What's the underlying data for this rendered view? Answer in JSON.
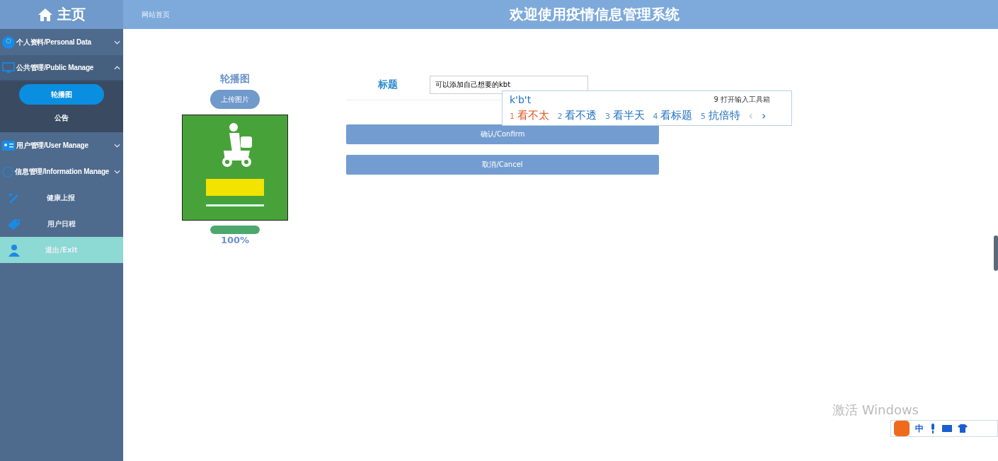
{
  "sidebar": {
    "home": "主页",
    "items": [
      {
        "kind": "group",
        "label": "个人资料/Personal Data",
        "expanded": false
      },
      {
        "kind": "group",
        "label": "公共管理/Public Manage",
        "expanded": true,
        "children": [
          {
            "label": "轮播图",
            "selected": true
          },
          {
            "label": "公告",
            "selected": false
          }
        ]
      },
      {
        "kind": "group",
        "label": "用户管理/User Manage",
        "expanded": false
      },
      {
        "kind": "group",
        "label": "信息管理/Information Manage",
        "expanded": false
      },
      {
        "kind": "link",
        "label": "健康上报",
        "selected": false
      },
      {
        "kind": "link",
        "label": "用户日程",
        "selected": false
      },
      {
        "kind": "link",
        "label": "退出/Exit",
        "selected": true
      }
    ]
  },
  "header": {
    "breadcrumb": "网站首页",
    "title": "欢迎使用疫情信息管理系统"
  },
  "upload": {
    "heading": "轮播图",
    "button": "上传图片",
    "progress": {
      "level": 1,
      "reading": "100%"
    }
  },
  "form": {
    "label": "标题",
    "value": "可以添加自己想要的kbt",
    "buttons": [
      "确认/Confirm",
      "取消/Cancel"
    ]
  },
  "ime": {
    "composition": "k'b't",
    "toolbox": "9 打开输入工具箱",
    "candidates": [
      {
        "index": "1",
        "text": "看不太",
        "selected": true
      },
      {
        "index": "2",
        "text": "看不透",
        "selected": false
      },
      {
        "index": "3",
        "text": "看半天",
        "selected": false
      },
      {
        "index": "4",
        "text": "看标题",
        "selected": false
      },
      {
        "index": "5",
        "text": "抗倍特",
        "selected": false
      }
    ],
    "prev": "‹",
    "next": "›"
  },
  "ime_bar": {
    "mode": "中"
  },
  "activation": "激活 Windows"
}
